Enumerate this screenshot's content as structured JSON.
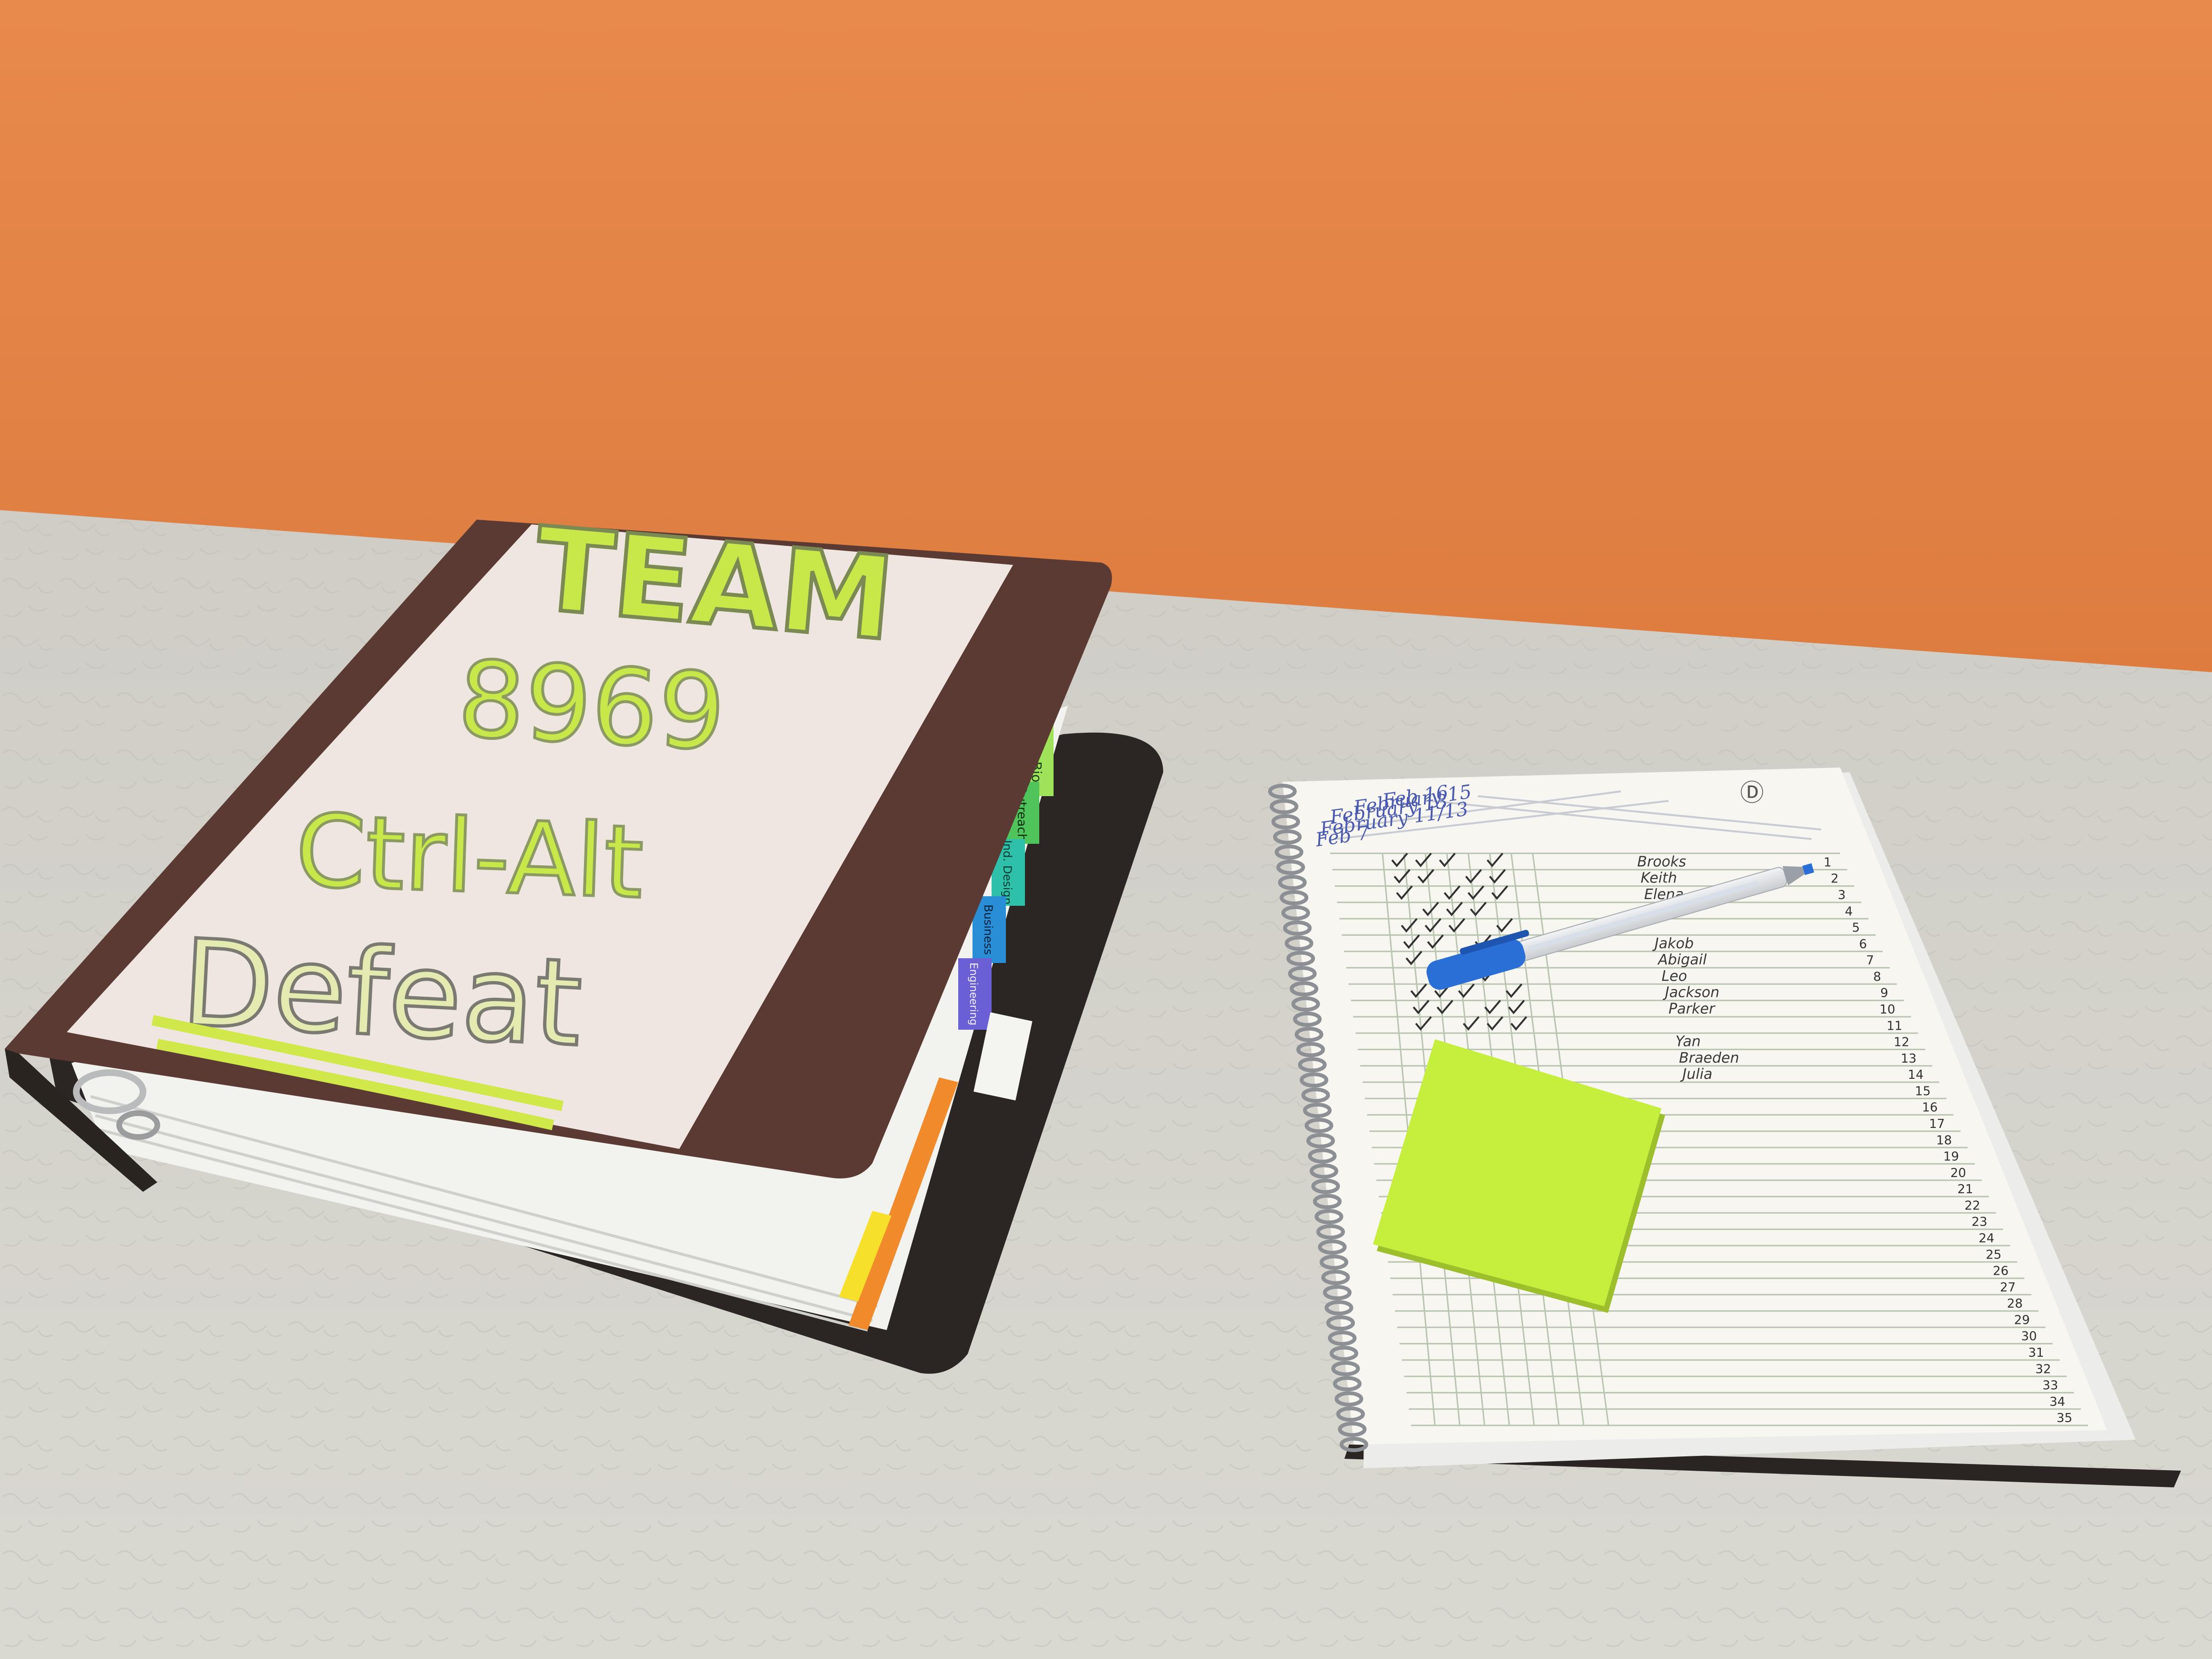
{
  "photo": {
    "colors": {
      "wall": "#e5864a",
      "wall_shadow": "#d4743a",
      "counter": "#d7d6cf",
      "binder_cover": "#5a3a33",
      "binder_back": "#2a2522",
      "cover_paper": "#efe6e1",
      "highlighter": "#c8e84a",
      "sticky_note": "#c6ee3c",
      "notebook_paper": "#f7f6f1",
      "grid_line": "#b9c4b1",
      "pen_blue": "#2a6fd6"
    },
    "binder": {
      "cover_lines": [
        "TEAM",
        "8969",
        "Ctrl-Alt",
        "Defeat"
      ],
      "tab_labels": [
        "Team Bios",
        "Outreach",
        "Ind. Design",
        "Business",
        "Engineering"
      ],
      "tab_colors": [
        "#9fe35a",
        "#4fc45a",
        "#2ec0a8",
        "#2a8ed6",
        "#6b5fd6"
      ]
    },
    "notebook": {
      "header_dates": [
        "Feb 16",
        "February 15",
        "February 13",
        "February 11/13",
        "Feb 7"
      ],
      "names": [
        "Brooks",
        "Keith",
        "Elena",
        "Kerri",
        "",
        "Jakob",
        "Abigail",
        "Leo",
        "Jackson",
        "Parker",
        "",
        "Yan",
        "Braeden",
        "Julia"
      ],
      "row_numbers": [
        "1",
        "2",
        "3",
        "4",
        "5",
        "6",
        "7",
        "8",
        "9",
        "10",
        "11",
        "12",
        "13",
        "14",
        "15",
        "16",
        "17",
        "18",
        "19",
        "20",
        "21",
        "22",
        "23",
        "24",
        "25",
        "26",
        "27",
        "28",
        "29",
        "30",
        "31",
        "32",
        "33",
        "34",
        "35"
      ],
      "corner_mark": "Ⓓ"
    }
  }
}
